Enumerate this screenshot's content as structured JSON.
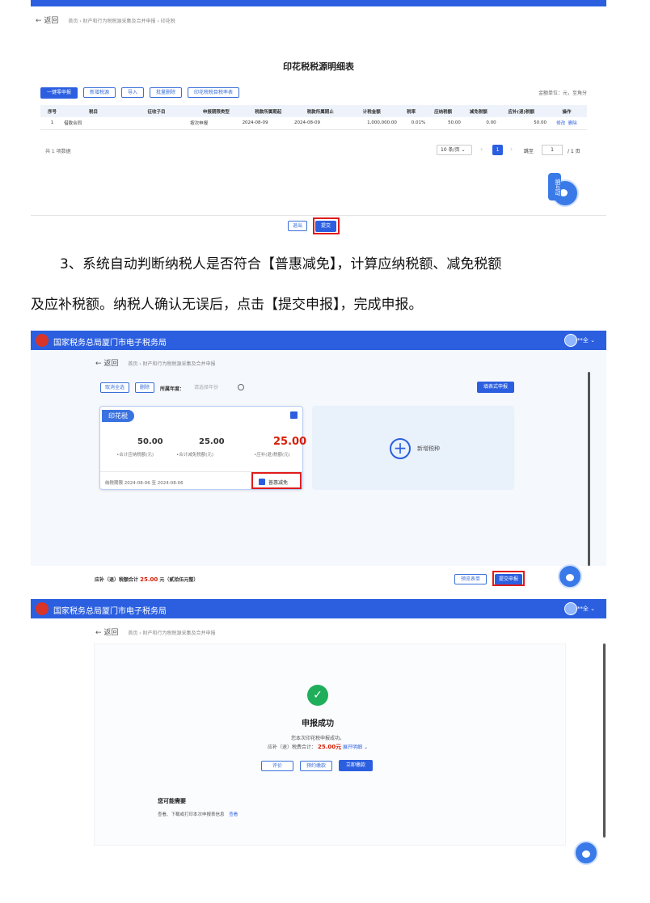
{
  "s1": {
    "back": "← 返回",
    "breadcrumb": "首页 › 财产和行为税税源采集及合并申报 › 印花税",
    "title": "印花税税源明细表",
    "buttons": [
      "一键零申报",
      "新增税源",
      "导入",
      "批量删除",
      "印花税税目税率表"
    ],
    "unit": "金额单位：元，至角分",
    "columns": [
      "序号",
      "税目",
      "征收子目",
      "申报期限类型",
      "税款所属期起",
      "税款所属期止",
      "计税金额",
      "税率",
      "应纳税额",
      "减免税额",
      "应补(退)税额",
      "操作"
    ],
    "row": [
      "1",
      "借款合同",
      "",
      "按次申报",
      "2024-08-09",
      "2024-08-09",
      "1,000,000.00",
      "0.01%",
      "50.00",
      "0.00",
      "50.00"
    ],
    "ops": [
      "修改",
      "删除"
    ],
    "total": "共 1 项数据",
    "page_size": "10 条/页 ⌄",
    "page_prev": "‹",
    "page_num": "1",
    "page_next": "›",
    "goto": "跳至",
    "goto_val": "1",
    "pages": "/ 1 页",
    "helper": "纳互动",
    "footer_back": "退出",
    "footer_submit": "提交"
  },
  "para1": "3、系统自动判断纳税人是否符合【普惠减免】，计算应纳税额、减免税额",
  "para2": "及应补税额。纳税人确认无误后，点击【提交申报】，完成申报。",
  "s2": {
    "header_title": "国家税务总局厦门市电子税务局",
    "user": "**全 ⌄",
    "back": "← 返回",
    "breadcrumb": "首页 › 财产和行为税税源采集及合并申报",
    "btn_cancel": "取消全选",
    "btn_delete": "删除",
    "period_label": "所属年度：",
    "period_placeholder": "请选择年份",
    "btn_form": "填表式申报",
    "card_tag": "印花税",
    "v1": "50.00",
    "l1": "•合计应纳税额(元)",
    "v2": "25.00",
    "l2": "•合计减免税额(元)",
    "v3": "25.00",
    "l3": "•应补(退)税额(元)",
    "period": "纳税期限 2024-08-06 至 2024-08-06",
    "puhui": "普惠减免",
    "add_label": "新增税种",
    "footer_label": "应补（退）税额合计",
    "footer_amount": "25.00",
    "footer_unit": "元（贰拾伍元整）",
    "btn_preview": "预览表单",
    "btn_submit": "提交申报"
  },
  "s3": {
    "header_title": "国家税务总局厦门市电子税务局",
    "user": "**全 ⌄",
    "back": "← 返回",
    "breadcrumb": "首页 › 财产和行为税税源采集及合并申报",
    "success_title": "申报成功",
    "msg1": "您本次印花税申报成功。",
    "msg2_label": "应补（退）税费合计：",
    "msg2_amount": "25.00元",
    "expand": "展开明细 ⌄",
    "btn1": "评价",
    "btn2": "预约缴款",
    "btn3": "立即缴款",
    "maybe_title": "您可能需要",
    "maybe_text": "查看、下载或打印本次申报表信息",
    "maybe_link": "查看"
  },
  "colors": {
    "primary": "#2b5fe0",
    "red_box": "#e01b1b",
    "amount_red": "#d81e06",
    "success": "#1fae5a"
  }
}
